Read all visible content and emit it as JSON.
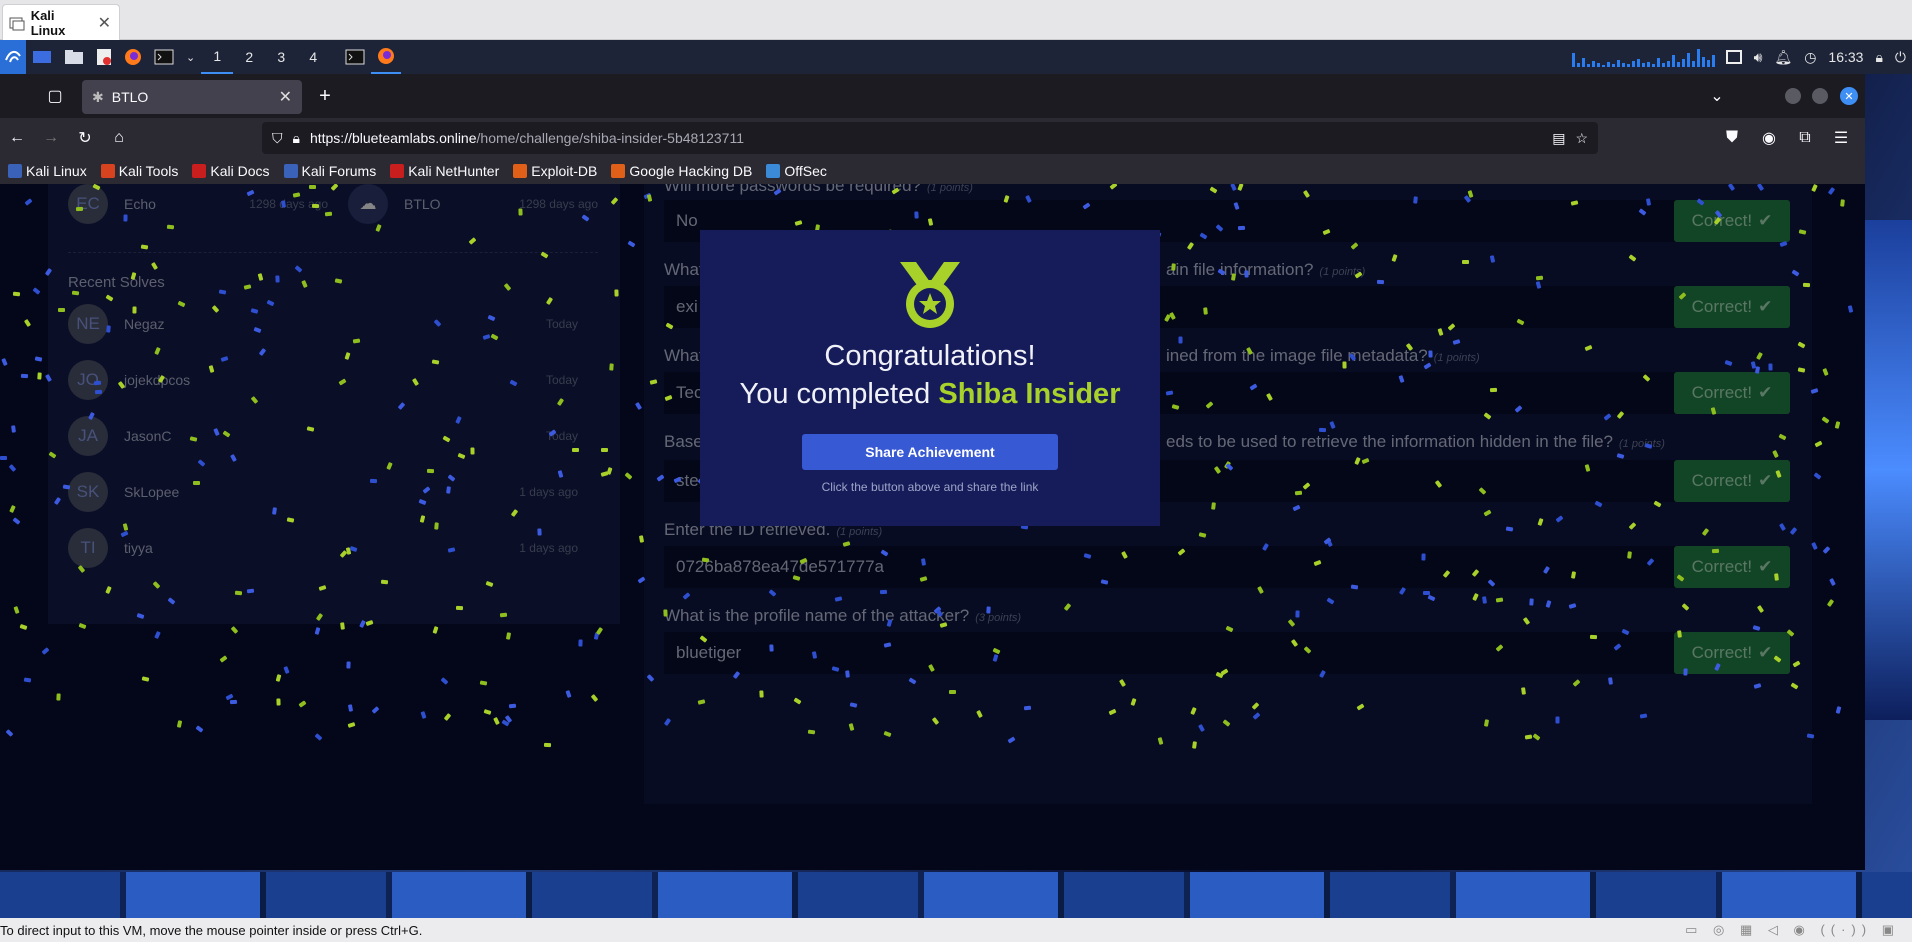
{
  "vm": {
    "tab_title": "Kali Linux",
    "status_text": "To direct input to this VM, move the mouse pointer inside or press Ctrl+G."
  },
  "panel": {
    "workspaces": [
      "1",
      "2",
      "3",
      "4"
    ],
    "clock": "16:33"
  },
  "browser": {
    "tab_title": "BTLO",
    "url_host": "https://blueteamlabs.online",
    "url_path": "/home/challenge/shiba-insider-5b48123711",
    "bookmarks": [
      "Kali Linux",
      "Kali Tools",
      "Kali Docs",
      "Kali Forums",
      "Kali NetHunter",
      "Exploit-DB",
      "Google Hacking DB",
      "OffSec"
    ]
  },
  "sidebar": {
    "top_users": [
      {
        "initials": "EC",
        "name": "Echo",
        "when": "1298 days ago"
      },
      {
        "initials": "",
        "name": "BTLO",
        "when": "1298 days ago"
      }
    ],
    "recent_solves_title": "Recent Solves",
    "recent_solves": [
      {
        "initials": "NE",
        "name": "Negaz",
        "when": "Today"
      },
      {
        "initials": "JO",
        "name": "jojekdpcos",
        "when": "Today"
      },
      {
        "initials": "JA",
        "name": "JasonC",
        "when": "Today"
      },
      {
        "initials": "SK",
        "name": "SkLopee",
        "when": "1 days ago"
      },
      {
        "initials": "TI",
        "name": "tiyya",
        "when": "1 days ago"
      }
    ]
  },
  "questions": [
    {
      "q": "Will more passwords be required?",
      "points": "(1 points)",
      "answer": "No",
      "status": "Correct!"
    },
    {
      "q": "What",
      "q_end": "ain file information?",
      "points": "(1 points)",
      "answer": "exi",
      "status": "Correct!"
    },
    {
      "q": "What",
      "q_end": "ined from the image file metadata?",
      "points": "(1 points)",
      "answer": "Tec",
      "status": "Correct!"
    },
    {
      "q": "Base",
      "q_end": "eds to be used to retrieve the information hidden in the file?",
      "points": "(1 points)",
      "answer": "steghide",
      "status": "Correct!"
    },
    {
      "q": "Enter the ID retrieved.",
      "points": "(1 points)",
      "answer": "0726ba878ea47de571777a",
      "status": "Correct!"
    },
    {
      "q": "What is the profile name of the attacker?",
      "points": "(3 points)",
      "answer": "bluetiger",
      "status": "Correct!"
    }
  ],
  "modal": {
    "line1": "Congratulations!",
    "line2_prefix": "You completed ",
    "challenge_name": "Shiba Insider",
    "share_button": "Share Achievement",
    "hint": "Click the button above and share the link"
  },
  "colors": {
    "accent_green": "#a8d12a",
    "share_blue": "#3859d4",
    "correct_green": "#1d6b39"
  }
}
